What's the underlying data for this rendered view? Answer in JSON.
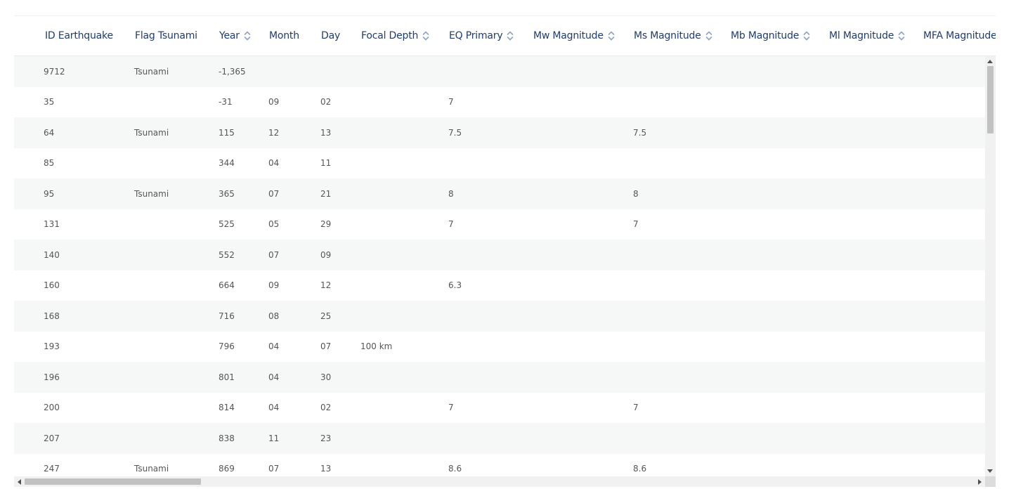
{
  "columns": [
    {
      "label": "ID Earthquake",
      "sortable": false
    },
    {
      "label": "Flag Tsunami",
      "sortable": false
    },
    {
      "label": "Year",
      "sortable": true
    },
    {
      "label": "Month",
      "sortable": false
    },
    {
      "label": "Day",
      "sortable": false
    },
    {
      "label": "Focal Depth",
      "sortable": true
    },
    {
      "label": "EQ Primary",
      "sortable": true
    },
    {
      "label": "Mw Magnitude",
      "sortable": true
    },
    {
      "label": "Ms Magnitude",
      "sortable": true
    },
    {
      "label": "Mb Magnitude",
      "sortable": true
    },
    {
      "label": "Ml Magnitude",
      "sortable": true
    },
    {
      "label": "MFA Magnitude",
      "sortable": true
    }
  ],
  "rows": [
    [
      "9712",
      "Tsunami",
      "-1,365",
      "",
      "",
      "",
      "",
      "",
      "",
      "",
      "",
      ""
    ],
    [
      "35",
      "",
      "-31",
      "09",
      "02",
      "",
      "7",
      "",
      "",
      "",
      "",
      ""
    ],
    [
      "64",
      "Tsunami",
      "115",
      "12",
      "13",
      "",
      "7.5",
      "",
      "7.5",
      "",
      "",
      ""
    ],
    [
      "85",
      "",
      "344",
      "04",
      "11",
      "",
      "",
      "",
      "",
      "",
      "",
      ""
    ],
    [
      "95",
      "Tsunami",
      "365",
      "07",
      "21",
      "",
      "8",
      "",
      "8",
      "",
      "",
      ""
    ],
    [
      "131",
      "",
      "525",
      "05",
      "29",
      "",
      "7",
      "",
      "7",
      "",
      "",
      ""
    ],
    [
      "140",
      "",
      "552",
      "07",
      "09",
      "",
      "",
      "",
      "",
      "",
      "",
      ""
    ],
    [
      "160",
      "",
      "664",
      "09",
      "12",
      "",
      "6.3",
      "",
      "",
      "",
      "",
      ""
    ],
    [
      "168",
      "",
      "716",
      "08",
      "25",
      "",
      "",
      "",
      "",
      "",
      "",
      ""
    ],
    [
      "193",
      "",
      "796",
      "04",
      "07",
      "100 km",
      "",
      "",
      "",
      "",
      "",
      ""
    ],
    [
      "196",
      "",
      "801",
      "04",
      "30",
      "",
      "",
      "",
      "",
      "",
      "",
      ""
    ],
    [
      "200",
      "",
      "814",
      "04",
      "02",
      "",
      "7",
      "",
      "7",
      "",
      "",
      ""
    ],
    [
      "207",
      "",
      "838",
      "11",
      "23",
      "",
      "",
      "",
      "",
      "",
      "",
      ""
    ],
    [
      "247",
      "Tsunami",
      "869",
      "07",
      "13",
      "",
      "8.6",
      "",
      "8.6",
      "",
      "",
      ""
    ]
  ],
  "colors": {
    "header_text": "#1f3b73",
    "cell_text": "#555555",
    "alt_row": "#f6f7f7",
    "sort_icon": "#8fa3c4"
  },
  "icons": {
    "sort": "sort-updown-icon"
  }
}
